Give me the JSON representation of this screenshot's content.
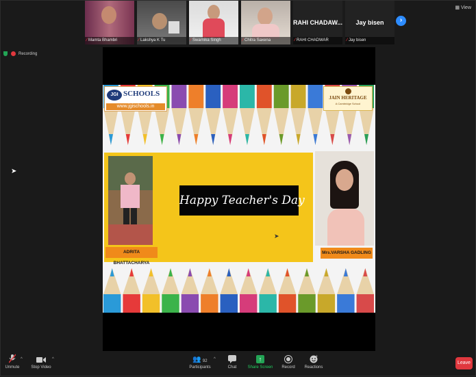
{
  "participants": [
    {
      "name": "Mamta Bhambri",
      "type": "video"
    },
    {
      "name": "Lakshya K Tu",
      "type": "video"
    },
    {
      "name": "Swarnika Singh",
      "type": "video"
    },
    {
      "name": "Chitra Saxena",
      "type": "video"
    },
    {
      "name": "RAHI CHADWAR",
      "display": "RAHI  CHADAW...",
      "type": "text"
    },
    {
      "name": "Jay bisen",
      "display": "Jay bisen",
      "type": "text"
    }
  ],
  "view_label": "View",
  "recording_label": "Recording",
  "slide": {
    "logo_left_title": "SCHOOLS",
    "logo_left_url": "www.jgischools.in",
    "logo_left_badge": "JGI",
    "logo_right_title": "JAIN HERITAGE",
    "logo_right_sub": "A Cambridge School",
    "banner": "Happy Teacher's Day",
    "caption_left": "ADRITA BHATTACHARYA",
    "caption_right": "Mrs.VARSHA GADLING"
  },
  "toolbar": {
    "unmute": "Unmute",
    "stop_video": "Stop Video",
    "participants": "Participants",
    "participant_count": "92",
    "chat": "Chat",
    "share_screen": "Share Screen",
    "record": "Record",
    "reactions": "Reactions",
    "leave": "Leave"
  }
}
